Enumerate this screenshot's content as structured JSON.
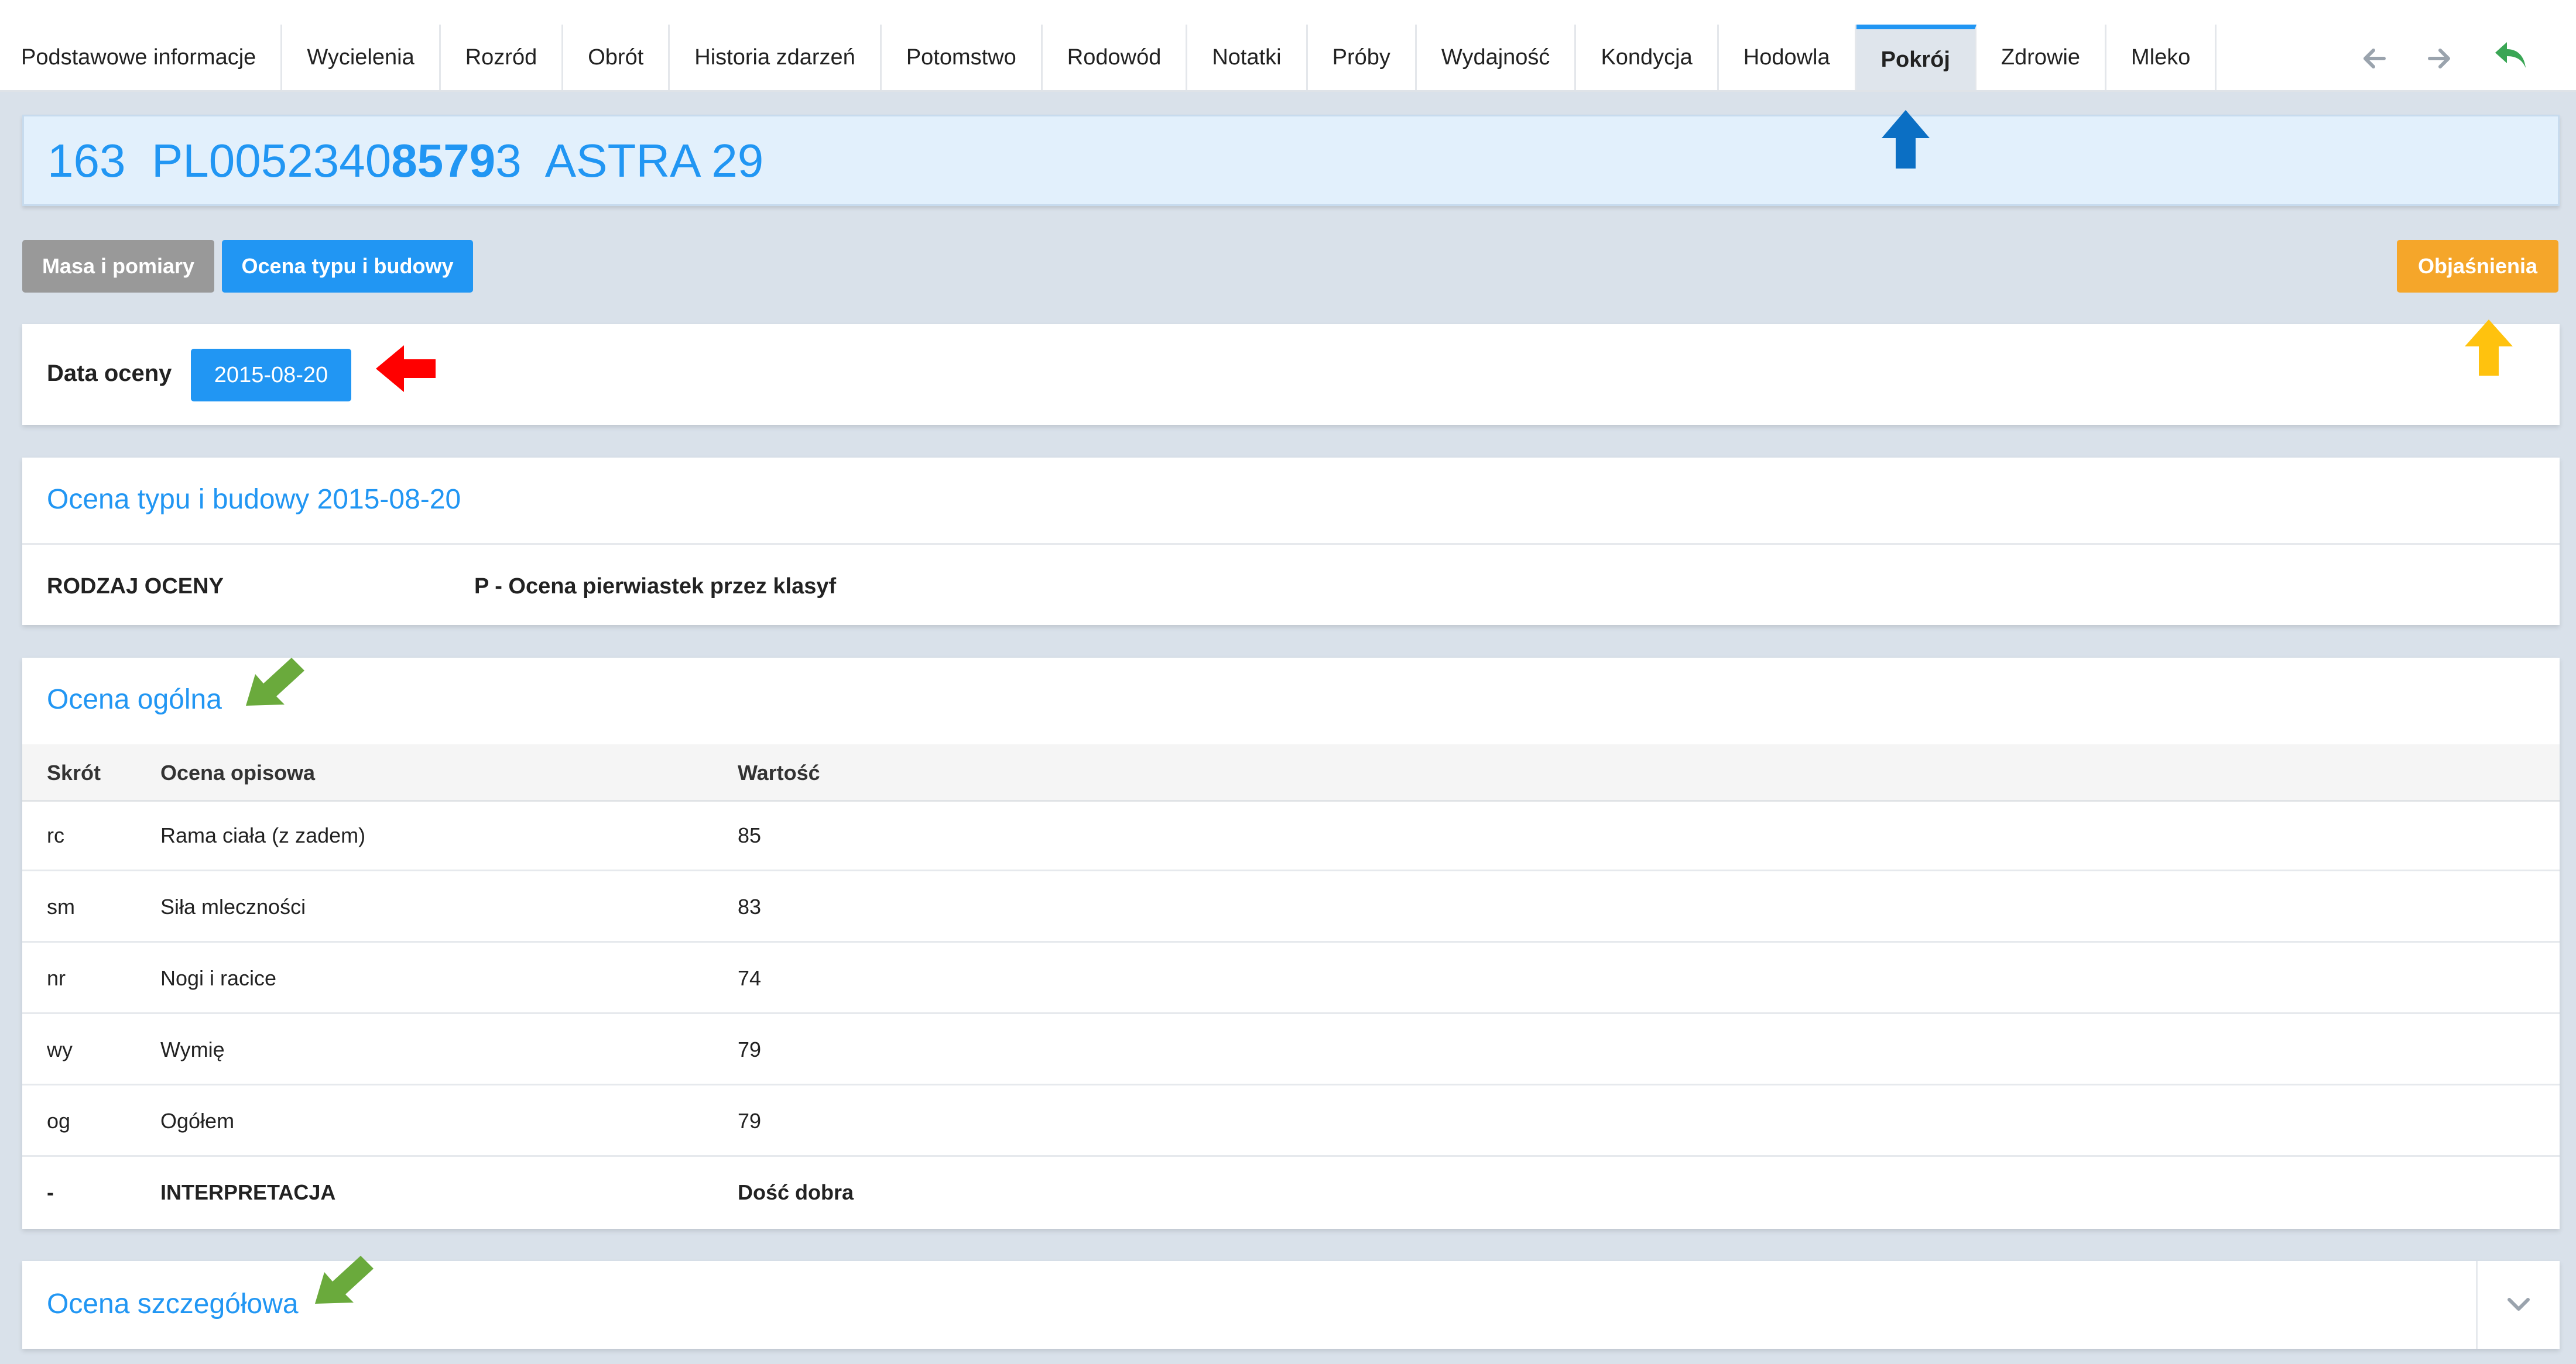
{
  "tabs": [
    {
      "label": "Podstawowe informacje"
    },
    {
      "label": "Wycielenia"
    },
    {
      "label": "Rozród"
    },
    {
      "label": "Obrót"
    },
    {
      "label": "Historia zdarzeń"
    },
    {
      "label": "Potomstwo"
    },
    {
      "label": "Rodowód"
    },
    {
      "label": "Notatki"
    },
    {
      "label": "Próby"
    },
    {
      "label": "Wydajność"
    },
    {
      "label": "Kondycja"
    },
    {
      "label": "Hodowla"
    },
    {
      "label": "Pokrój",
      "active": true
    },
    {
      "label": "Zdrowie"
    },
    {
      "label": "Mleko"
    }
  ],
  "nav": {
    "back_icon": "arrow-left-icon",
    "forward_icon": "arrow-right-icon",
    "return_icon": "reply-icon",
    "return_color": "#3aa655"
  },
  "animal": {
    "number": "163",
    "id_prefix": "PL0052340",
    "id_bold": "8579",
    "id_suffix": "3",
    "name": "ASTRA 29"
  },
  "buttons": {
    "measurements": "Masa i pomiary",
    "type_assessment": "Ocena typu i budowy",
    "explanations": "Objaśnienia"
  },
  "assessment_date": {
    "label": "Data oceny",
    "value": "2015-08-20"
  },
  "type_section": {
    "title": "Ocena typu i budowy 2015-08-20",
    "kind_label": "RODZAJ OCENY",
    "kind_value": "P - Ocena pierwiastek przez klasyf"
  },
  "general": {
    "title": "Ocena ogólna",
    "headers": {
      "abbr": "Skrót",
      "desc": "Ocena opisowa",
      "value": "Wartość"
    },
    "rows": [
      {
        "abbr": "rc",
        "desc": "Rama ciała (z zadem)",
        "value": "85"
      },
      {
        "abbr": "sm",
        "desc": "Siła mleczności",
        "value": "83"
      },
      {
        "abbr": "nr",
        "desc": "Nogi i racice",
        "value": "74"
      },
      {
        "abbr": "wy",
        "desc": "Wymię",
        "value": "79"
      },
      {
        "abbr": "og",
        "desc": "Ogółem",
        "value": "79"
      },
      {
        "abbr": "-",
        "desc": "INTERPRETACJA",
        "value": "Dość dobra",
        "bold": true
      }
    ]
  },
  "detail": {
    "title": "Ocena szczegółowa"
  },
  "colors": {
    "accent": "#2196f3",
    "orange": "#f5a62a",
    "grey_button": "#999999",
    "arrow_blue": "#0b6fc4",
    "arrow_red": "#ff0000",
    "arrow_yellow": "#ffc20e",
    "arrow_green": "#6aaa3c"
  }
}
